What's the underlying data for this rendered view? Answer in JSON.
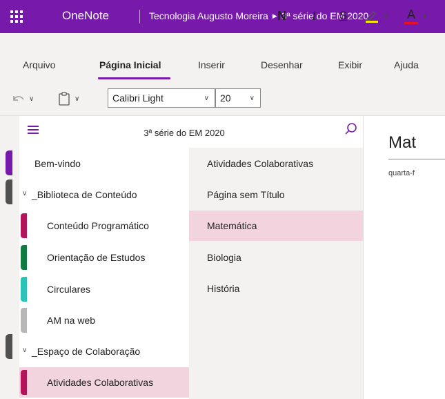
{
  "titlebar": {
    "app_name": "OneNote",
    "breadcrumb": [
      "Tecnologia Augusto Moreira",
      "3ª série do EM 2020"
    ],
    "background": "#7719aa"
  },
  "ribbon": {
    "tabs": [
      "Arquivo",
      "Página Inicial",
      "Inserir",
      "Desenhar",
      "Exibir",
      "Ajuda"
    ],
    "active_tab": "Página Inicial"
  },
  "toolbar": {
    "undo_icon": "undo-icon",
    "clipboard_icon": "clipboard-icon",
    "font_name": "Calibri Light",
    "font_size": "20",
    "bold_label": "N",
    "italic_label": "I",
    "strike_label": "S",
    "highlight_icon": "highlighter-icon",
    "font_color_label": "A",
    "highlight_color": "#f2e600",
    "font_color": "#e81123"
  },
  "section_pane": {
    "title": "3ª série do EM 2020",
    "items": [
      {
        "label": "Bem-vindo",
        "type": "section",
        "color": ""
      },
      {
        "label": "_Biblioteca de Conteúdo",
        "type": "group",
        "color": ""
      },
      {
        "label": "Conteúdo Programático",
        "type": "section",
        "color": "#b4145a"
      },
      {
        "label": "Orientação de Estudos",
        "type": "section",
        "color": "#107c41"
      },
      {
        "label": "Circulares",
        "type": "section",
        "color": "#2bc3b5"
      },
      {
        "label": "AM na web",
        "type": "section",
        "color": "#b7b7b7"
      },
      {
        "label": "_Espaço de Colaboração",
        "type": "group",
        "color": ""
      },
      {
        "label": "Atividades Colaborativas",
        "type": "section",
        "color": "#b4145a",
        "selected": true
      }
    ]
  },
  "pages_pane": {
    "items": [
      {
        "label": "Atividades Colaborativas"
      },
      {
        "label": "Página sem Título"
      },
      {
        "label": "Matemática",
        "selected": true
      },
      {
        "label": "Biologia"
      },
      {
        "label": "História"
      }
    ]
  },
  "canvas": {
    "page_title": "Mat",
    "page_date": "quarta-f"
  },
  "colors": {
    "accent": "#7719aa",
    "selection": "#f2d4de",
    "notebook_rail_tabs": [
      "#7719aa",
      "#505050",
      "#505050"
    ]
  }
}
